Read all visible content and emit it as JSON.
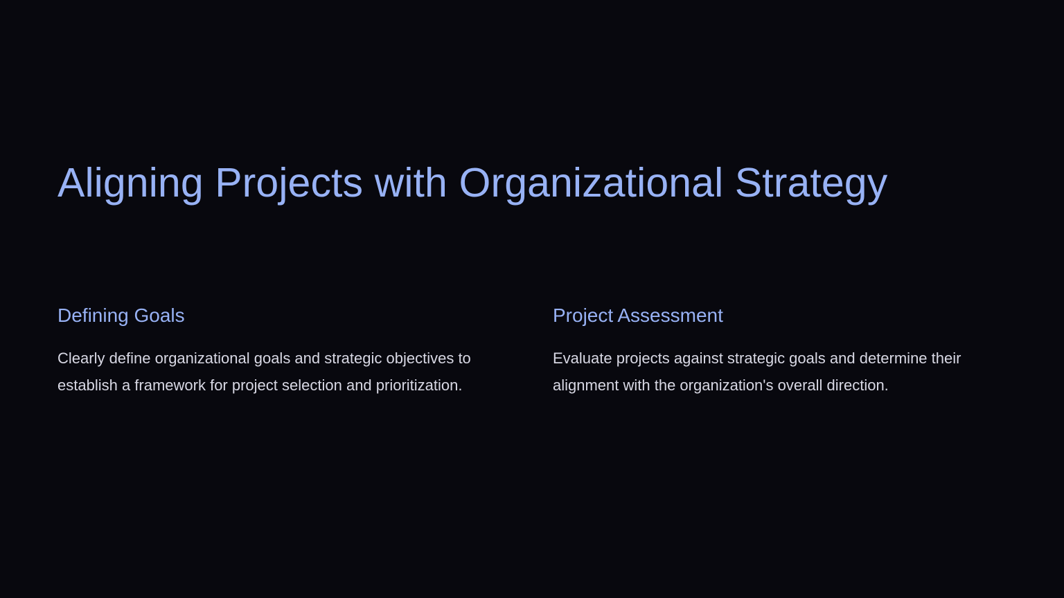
{
  "theme": {
    "background": "#08080e",
    "accent": "#98b2f5",
    "body_text": "#d8d8e4"
  },
  "slide": {
    "title": "Aligning Projects with Organizational Strategy",
    "columns": [
      {
        "heading": "Defining Goals",
        "body": "Clearly define organizational goals and strategic objectives to establish a framework for project selection and prioritization."
      },
      {
        "heading": "Project Assessment",
        "body": "Evaluate projects against strategic goals and determine their alignment with the organization's overall direction."
      }
    ]
  }
}
